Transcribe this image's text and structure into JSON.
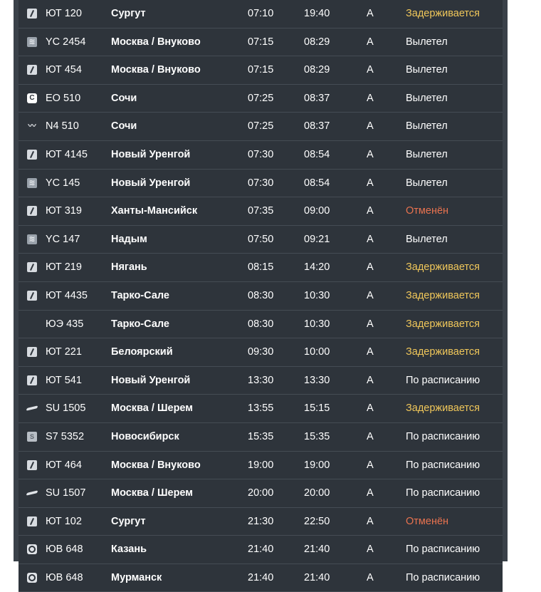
{
  "colors": {
    "delayed": "#f0c75a",
    "cancelled": "#e8724f",
    "normal": "#ffffff",
    "row_bg": "#2e343b",
    "frame_bg": "#3a4149"
  },
  "flights": [
    {
      "airline_icon": "utair",
      "flight": "ЮТ 120",
      "destination": "Сургут",
      "scheduled": "07:10",
      "actual": "19:40",
      "terminal": "A",
      "status": "Задерживается",
      "status_type": "delayed"
    },
    {
      "airline_icon": "yamal",
      "flight": "YC 2454",
      "destination": "Москва / Внуково",
      "scheduled": "07:15",
      "actual": "08:29",
      "terminal": "A",
      "status": "Вылетел",
      "status_type": "normal"
    },
    {
      "airline_icon": "utair",
      "flight": "ЮТ 454",
      "destination": "Москва / Внуково",
      "scheduled": "07:15",
      "actual": "08:29",
      "terminal": "A",
      "status": "Вылетел",
      "status_type": "normal"
    },
    {
      "airline_icon": "ural",
      "flight": "EO 510",
      "destination": "Сочи",
      "scheduled": "07:25",
      "actual": "08:37",
      "terminal": "A",
      "status": "Вылетел",
      "status_type": "normal"
    },
    {
      "airline_icon": "nordwind",
      "flight": "N4 510",
      "destination": "Сочи",
      "scheduled": "07:25",
      "actual": "08:37",
      "terminal": "A",
      "status": "Вылетел",
      "status_type": "normal"
    },
    {
      "airline_icon": "utair",
      "flight": "ЮТ 4145",
      "destination": "Новый Уренгой",
      "scheduled": "07:30",
      "actual": "08:54",
      "terminal": "A",
      "status": "Вылетел",
      "status_type": "normal"
    },
    {
      "airline_icon": "yamal",
      "flight": "YC 145",
      "destination": "Новый Уренгой",
      "scheduled": "07:30",
      "actual": "08:54",
      "terminal": "A",
      "status": "Вылетел",
      "status_type": "normal"
    },
    {
      "airline_icon": "utair",
      "flight": "ЮТ 319",
      "destination": "Ханты-Мансийск",
      "scheduled": "07:35",
      "actual": "09:00",
      "terminal": "A",
      "status": "Отменён",
      "status_type": "cancelled"
    },
    {
      "airline_icon": "yamal",
      "flight": "YC 147",
      "destination": "Надым",
      "scheduled": "07:50",
      "actual": "09:21",
      "terminal": "A",
      "status": "Вылетел",
      "status_type": "normal"
    },
    {
      "airline_icon": "utair",
      "flight": "ЮТ 219",
      "destination": "Нягань",
      "scheduled": "08:15",
      "actual": "14:20",
      "terminal": "A",
      "status": "Задерживается",
      "status_type": "delayed"
    },
    {
      "airline_icon": "utair",
      "flight": "ЮТ 4435",
      "destination": "Тарко-Сале",
      "scheduled": "08:30",
      "actual": "10:30",
      "terminal": "A",
      "status": "Задерживается",
      "status_type": "delayed"
    },
    {
      "airline_icon": "none",
      "flight": "ЮЭ 435",
      "destination": "Тарко-Сале",
      "scheduled": "08:30",
      "actual": "10:30",
      "terminal": "A",
      "status": "Задерживается",
      "status_type": "delayed"
    },
    {
      "airline_icon": "utair",
      "flight": "ЮТ 221",
      "destination": "Белоярский",
      "scheduled": "09:30",
      "actual": "10:00",
      "terminal": "A",
      "status": "Задерживается",
      "status_type": "delayed"
    },
    {
      "airline_icon": "utair",
      "flight": "ЮТ 541",
      "destination": "Новый Уренгой",
      "scheduled": "13:30",
      "actual": "13:30",
      "terminal": "A",
      "status": "По расписанию",
      "status_type": "normal"
    },
    {
      "airline_icon": "aeroflot",
      "flight": "SU 1505",
      "destination": "Москва / Шерем",
      "scheduled": "13:55",
      "actual": "15:15",
      "terminal": "A",
      "status": "Задерживается",
      "status_type": "delayed"
    },
    {
      "airline_icon": "s7",
      "flight": "S7 5352",
      "destination": "Новосибирск",
      "scheduled": "15:35",
      "actual": "15:35",
      "terminal": "A",
      "status": "По расписанию",
      "status_type": "normal"
    },
    {
      "airline_icon": "utair",
      "flight": "ЮТ 464",
      "destination": "Москва / Внуково",
      "scheduled": "19:00",
      "actual": "19:00",
      "terminal": "A",
      "status": "По расписанию",
      "status_type": "normal"
    },
    {
      "airline_icon": "aeroflot",
      "flight": "SU 1507",
      "destination": "Москва / Шерем",
      "scheduled": "20:00",
      "actual": "20:00",
      "terminal": "A",
      "status": "По расписанию",
      "status_type": "normal"
    },
    {
      "airline_icon": "utair",
      "flight": "ЮТ 102",
      "destination": "Сургут",
      "scheduled": "21:30",
      "actual": "22:50",
      "terminal": "A",
      "status": "Отменён",
      "status_type": "cancelled"
    },
    {
      "airline_icon": "pobeda",
      "flight": "ЮВ 648",
      "destination": "Казань",
      "scheduled": "21:40",
      "actual": "21:40",
      "terminal": "A",
      "status": "По расписанию",
      "status_type": "normal"
    },
    {
      "airline_icon": "pobeda",
      "flight": "ЮВ 648",
      "destination": "Мурманск",
      "scheduled": "21:40",
      "actual": "21:40",
      "terminal": "A",
      "status": "По расписанию",
      "status_type": "normal"
    }
  ]
}
